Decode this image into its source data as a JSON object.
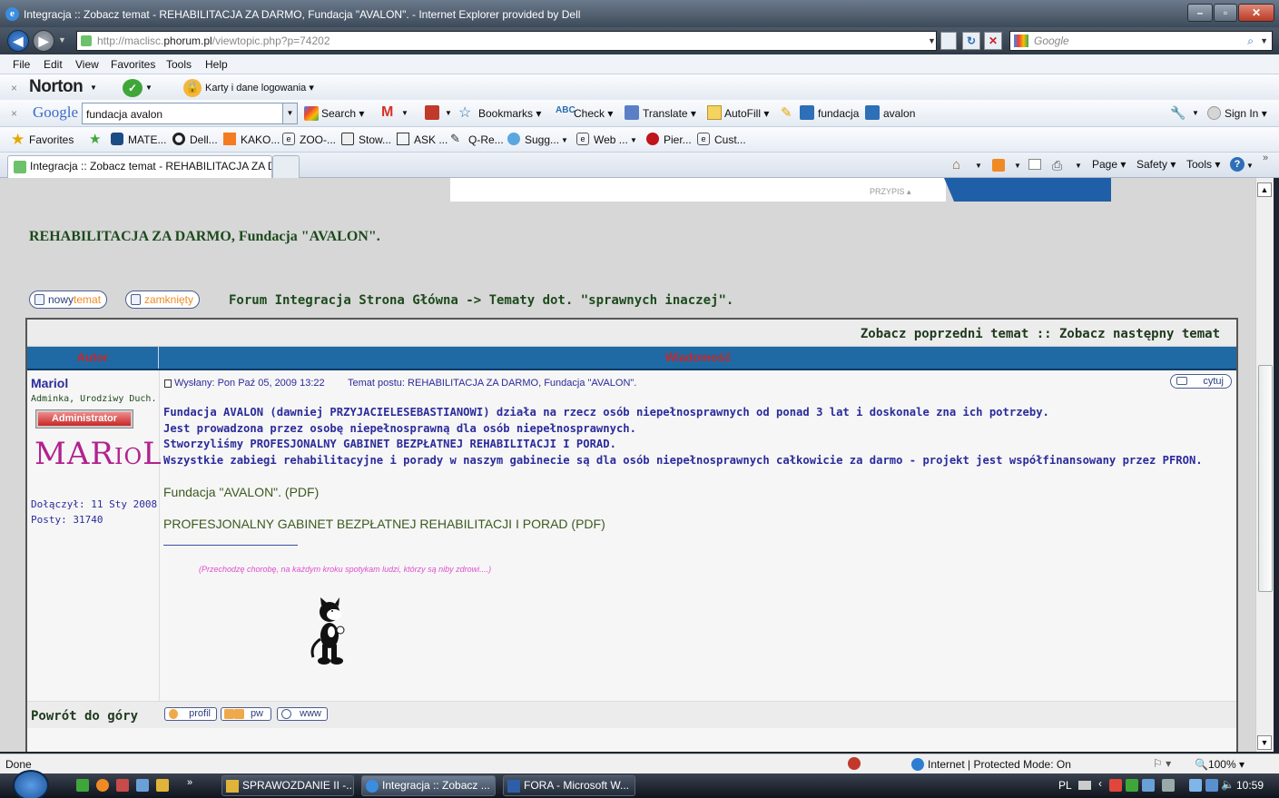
{
  "window": {
    "title": "Integracja :: Zobacz temat - REHABILITACJA ZA DARMO, Fundacja \"AVALON\". - Internet Explorer provided by Dell"
  },
  "address": {
    "url_prefix": "http://maclisc.",
    "url_domain": "phorum.pl",
    "url_rest": "/viewtopic.php?p=74202",
    "search_placeholder": "Google"
  },
  "menu": [
    "File",
    "Edit",
    "View",
    "Favorites",
    "Tools",
    "Help"
  ],
  "norton": {
    "brand": "Norton",
    "karty": "Karty i dane logowania"
  },
  "google_toolbar": {
    "logo": "Google",
    "query": "fundacja avalon",
    "search": "Search",
    "mail": "M",
    "bookmarks": "Bookmarks",
    "check": "Check",
    "translate": "Translate",
    "autofill": "AutoFill",
    "word1": "fundacja",
    "word2": "avalon",
    "sign_in": "Sign In"
  },
  "favorites": {
    "label": "Favorites",
    "items": [
      "MATE...",
      "Dell...",
      "KAKO...",
      "ZOO-...",
      "Stow...",
      "ASK ...",
      "Q-Re...",
      "Sugg...",
      "Web ...",
      "Pier...",
      "Cust..."
    ]
  },
  "tabs": {
    "active": "Integracja :: Zobacz temat - REHABILITACJA ZA D...",
    "cmd": [
      "Page",
      "Safety",
      "Tools"
    ]
  },
  "page": {
    "ad_label": "PRZYPIS",
    "topic_title": "REHABILITACJA ZA DARMO, Fundacja \"AVALON\".",
    "new_topic_a": "nowy",
    "new_topic_b": "temat",
    "closed": "zamknięty",
    "breadcrumb": "Forum Integracja Strona Główna -> Tematy dot. \"sprawnych inaczej\".",
    "prev_next": "Zobacz poprzedni temat :: Zobacz następny temat",
    "col_author": "Autor",
    "col_message": "Wiadomość",
    "author": {
      "name": "Mariol",
      "rank": "Adminka, Urodziwy Duch.",
      "badge": "Administrator",
      "signature_img": "MARioL",
      "joined": "Dołączył: 11 Sty 2008",
      "posts": "Posty: 31740"
    },
    "post_header": {
      "sent": "Wysłany: Pon Paź 05, 2009 13:22",
      "subject": "Temat postu: REHABILITACJA ZA DARMO, Fundacja \"AVALON\".",
      "quote": "cytuj"
    },
    "body_lines": [
      "Fundacja AVALON (dawniej PRZYJACIELESEBASTIANOWI) działa na rzecz osób niepełnosprawnych od ponad 3 lat i doskonale zna ich potrzeby.",
      "Jest prowadzona przez osobę niepełnosprawną dla osób niepełnosprawnych.",
      "Stworzyliśmy PROFESJONALNY GABINET BEZPŁATNEJ REHABILITACJI I PORAD.",
      "Wszystkie zabiegi rehabilitacyjne i porady w naszym gabinecie są dla osób niepełnosprawnych całkowicie za darmo - projekt jest współfinansowany przez PFRON."
    ],
    "link1": "Fundacja \"AVALON\". (PDF)",
    "link2": "PROFESJONALNY GABINET BEZPŁATNEJ REHABILITACJI I PORAD (PDF)",
    "signature_quote": "(Przechodzę chorobę, na każdym kroku spotykam ludzi, którzy są niby zdrowi....)",
    "back_to_top": "Powrót do góry",
    "profile": "profil",
    "pm": "pw",
    "www": "www"
  },
  "status": {
    "left": "Done",
    "zone": "Internet | Protected Mode: On",
    "zoom": "100%"
  },
  "taskbar": {
    "tasks": [
      "SPRAWOZDANIE II -...",
      "Integracja :: Zobacz ...",
      "FORA - Microsoft W..."
    ],
    "lang": "PL",
    "clock": "10:59"
  },
  "colors": {
    "forum_header": "#1f6aa5",
    "forum_header_text": "#c62828",
    "post_text": "#2b2b9c",
    "link_green": "#3b5a1e"
  }
}
